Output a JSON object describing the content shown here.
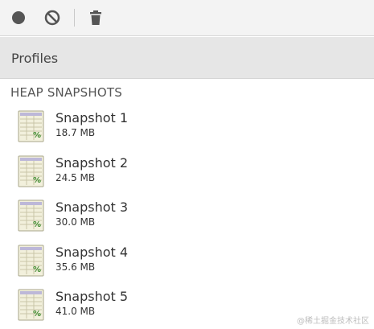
{
  "toolbar": {
    "buttons": [
      {
        "name": "record",
        "icon": "record-icon"
      },
      {
        "name": "clear",
        "icon": "clear-icon"
      },
      {
        "name": "delete",
        "icon": "trash-icon"
      }
    ]
  },
  "section": {
    "title": "Profiles"
  },
  "group": {
    "title": "HEAP SNAPSHOTS"
  },
  "snapshots": [
    {
      "name": "Snapshot 1",
      "size": "18.7 MB"
    },
    {
      "name": "Snapshot 2",
      "size": "24.5 MB"
    },
    {
      "name": "Snapshot 3",
      "size": "30.0 MB"
    },
    {
      "name": "Snapshot 4",
      "size": "35.6 MB"
    },
    {
      "name": "Snapshot 5",
      "size": "41.0 MB"
    }
  ],
  "watermark": "@稀土掘金技术社区",
  "colors": {
    "toolbar_bg": "#f3f3f3",
    "header_bg": "#e6e6e6",
    "icon_fill": "#555555"
  }
}
